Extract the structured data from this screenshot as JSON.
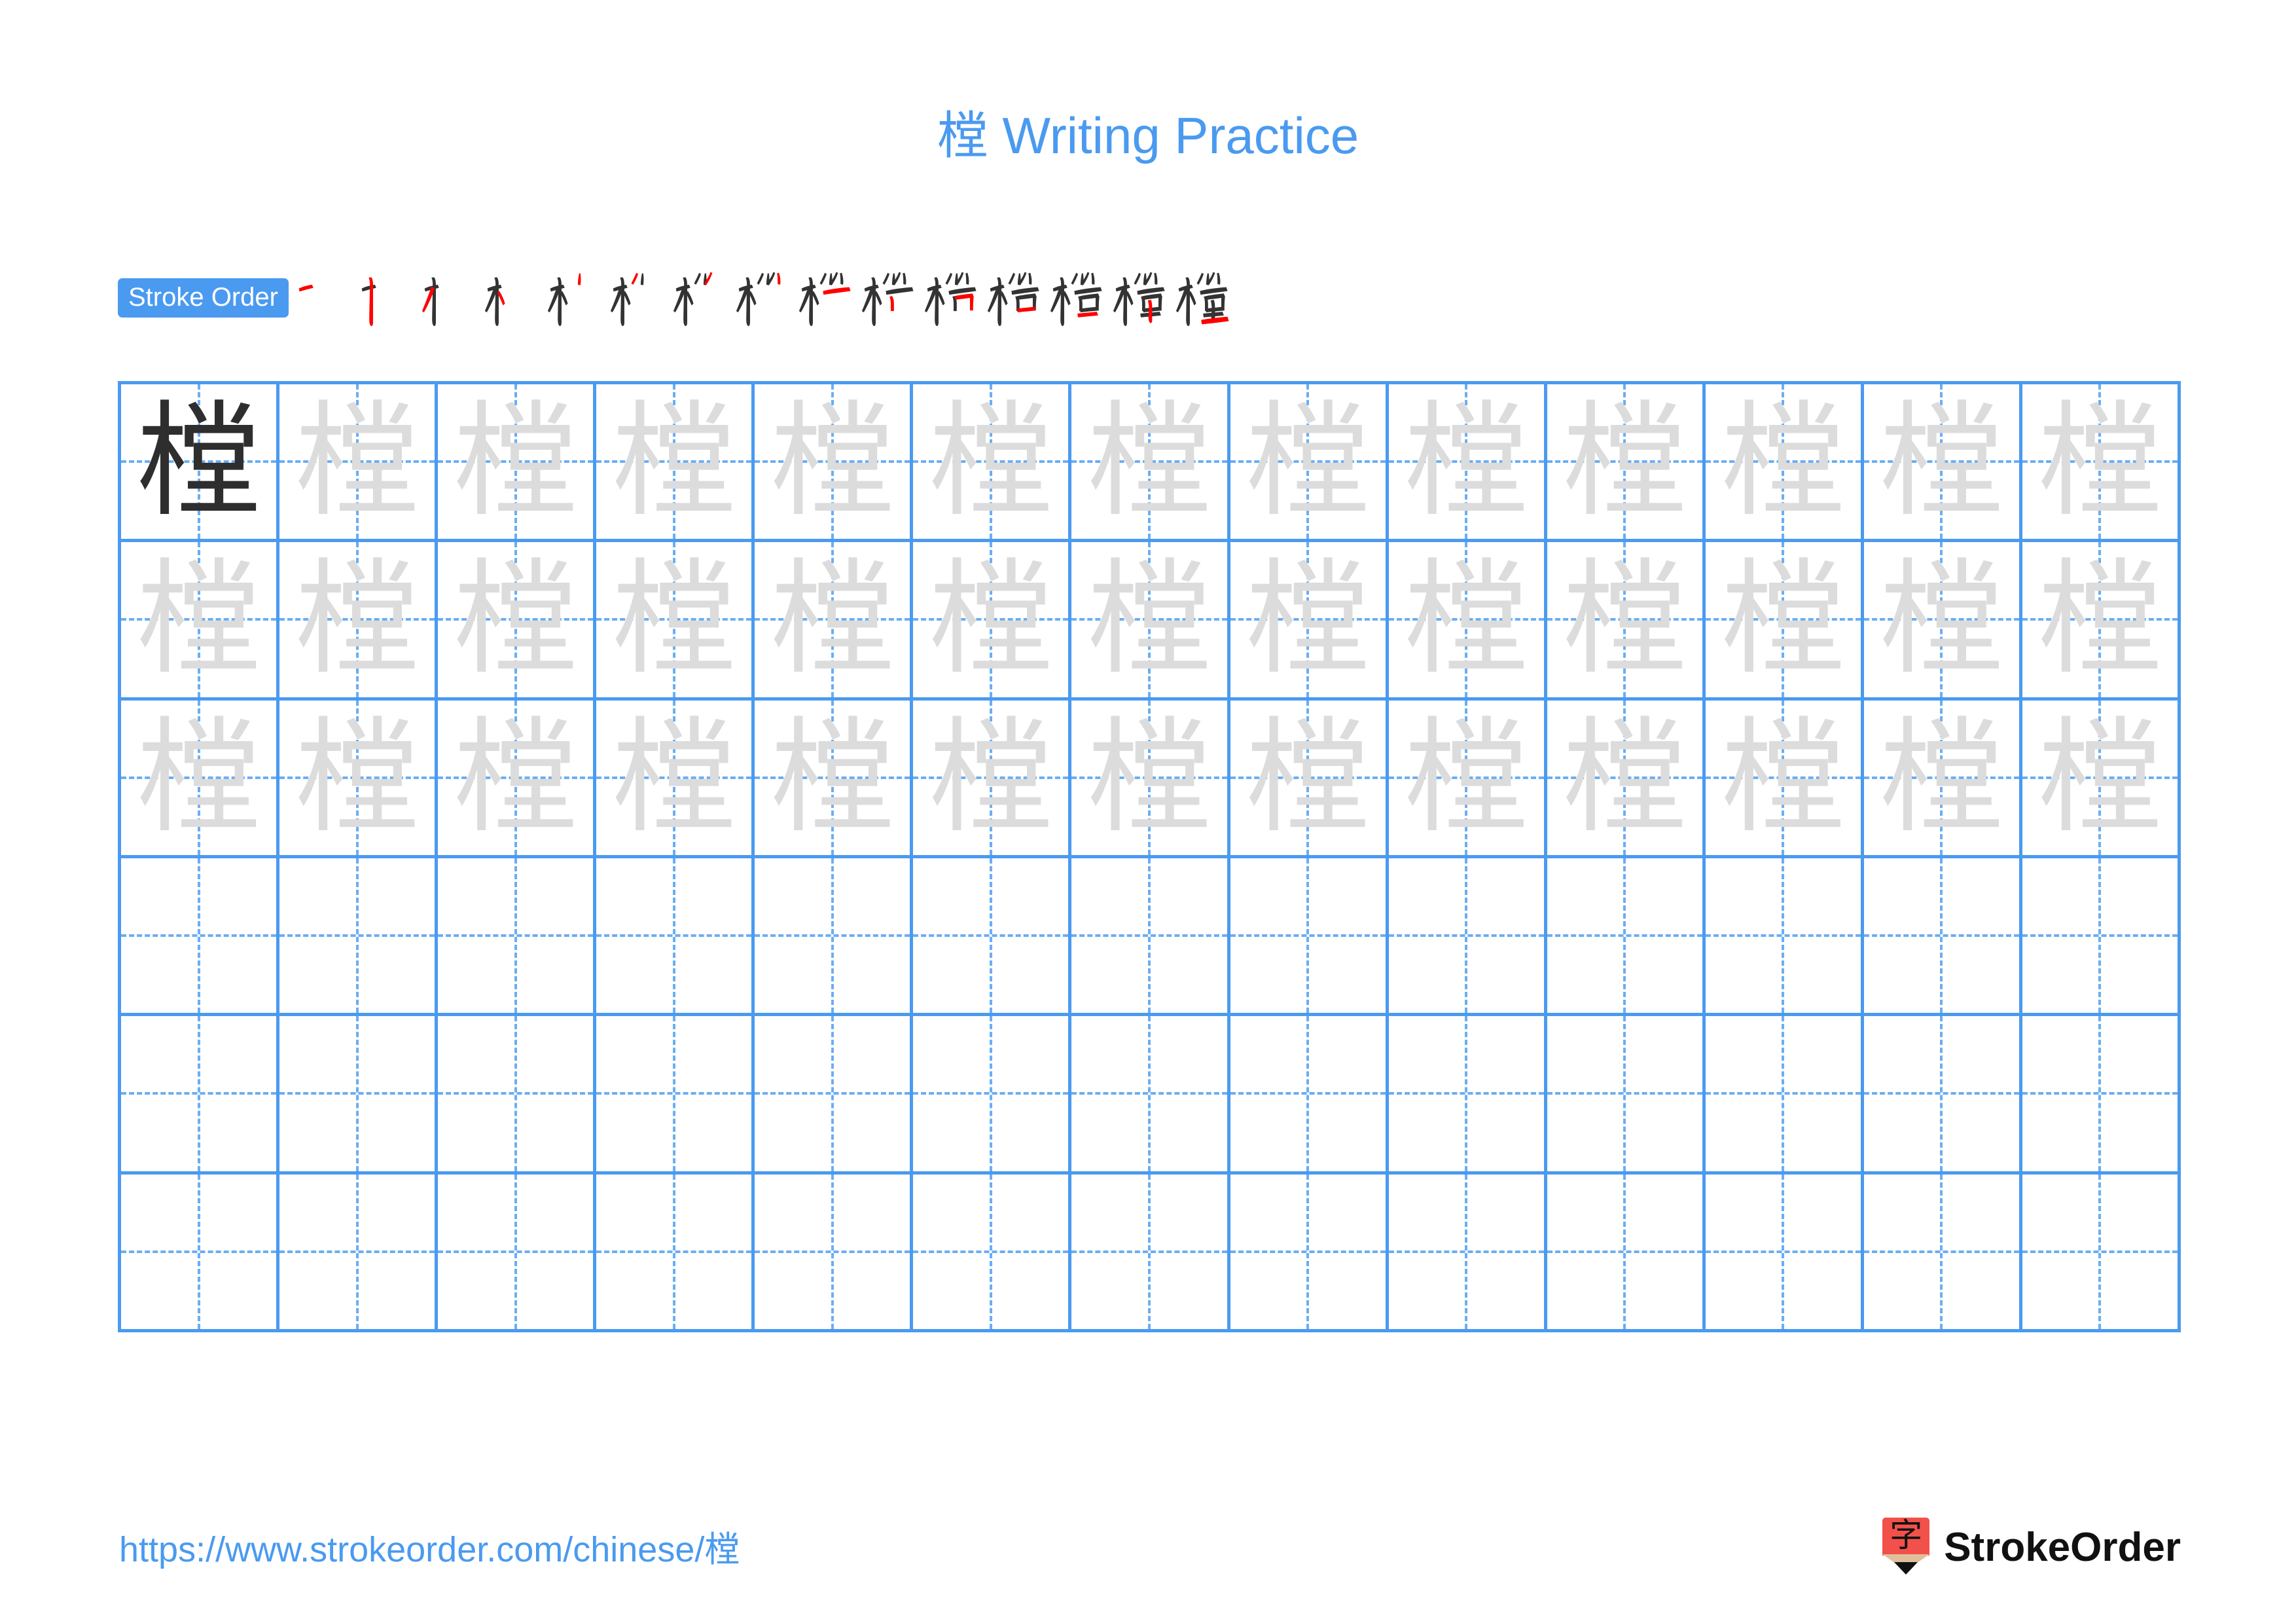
{
  "character": "樘",
  "title": {
    "character": "樘",
    "text": " Writing Practice",
    "full": "樘 Writing Practice"
  },
  "stroke_order": {
    "badge_label": "Stroke Order",
    "stroke_count": 15,
    "current_stroke_color": "#ff0000",
    "completed_stroke_color": "#333333",
    "frames": [
      {
        "index": 1,
        "strokes_shown": 1
      },
      {
        "index": 2,
        "strokes_shown": 2
      },
      {
        "index": 3,
        "strokes_shown": 3
      },
      {
        "index": 4,
        "strokes_shown": 4
      },
      {
        "index": 5,
        "strokes_shown": 5
      },
      {
        "index": 6,
        "strokes_shown": 6
      },
      {
        "index": 7,
        "strokes_shown": 7
      },
      {
        "index": 8,
        "strokes_shown": 8
      },
      {
        "index": 9,
        "strokes_shown": 9
      },
      {
        "index": 10,
        "strokes_shown": 10
      },
      {
        "index": 11,
        "strokes_shown": 11
      },
      {
        "index": 12,
        "strokes_shown": 12
      },
      {
        "index": 13,
        "strokes_shown": 13
      },
      {
        "index": 14,
        "strokes_shown": 14
      },
      {
        "index": 15,
        "strokes_shown": 15
      }
    ]
  },
  "practice_grid": {
    "columns": 13,
    "rows": 6,
    "filled_rows": 3,
    "empty_rows": 3,
    "solid_cells": 1,
    "grid_line_color": "#4a9af0",
    "guide_line_color": "#6aaef4",
    "solid_char_color": "#2e2e2e",
    "ghost_char_color": "#dcdcdc",
    "row_contents": [
      [
        "樘",
        "樘",
        "樘",
        "樘",
        "樘",
        "樘",
        "樘",
        "樘",
        "樘",
        "樘",
        "樘",
        "樘",
        "樘"
      ],
      [
        "樘",
        "樘",
        "樘",
        "樘",
        "樘",
        "樘",
        "樘",
        "樘",
        "樘",
        "樘",
        "樘",
        "樘",
        "樘"
      ],
      [
        "樘",
        "樘",
        "樘",
        "樘",
        "樘",
        "樘",
        "樘",
        "樘",
        "樘",
        "樘",
        "樘",
        "樘",
        "樘"
      ],
      [
        "",
        "",
        "",
        "",
        "",
        "",
        "",
        "",
        "",
        "",
        "",
        "",
        ""
      ],
      [
        "",
        "",
        "",
        "",
        "",
        "",
        "",
        "",
        "",
        "",
        "",
        "",
        ""
      ],
      [
        "",
        "",
        "",
        "",
        "",
        "",
        "",
        "",
        "",
        "",
        "",
        "",
        ""
      ]
    ]
  },
  "footer": {
    "url": "https://www.strokeorder.com/chinese/樘",
    "brand_name": "StrokeOrder",
    "brand_mark_char": "字",
    "brand_mark_color": "#f2504b",
    "brand_wood_color": "#e0c09a"
  },
  "colors": {
    "accent_blue": "#4a9af0",
    "red": "#ff0000",
    "ink": "#2e2e2e",
    "ghost": "#dcdcdc"
  }
}
